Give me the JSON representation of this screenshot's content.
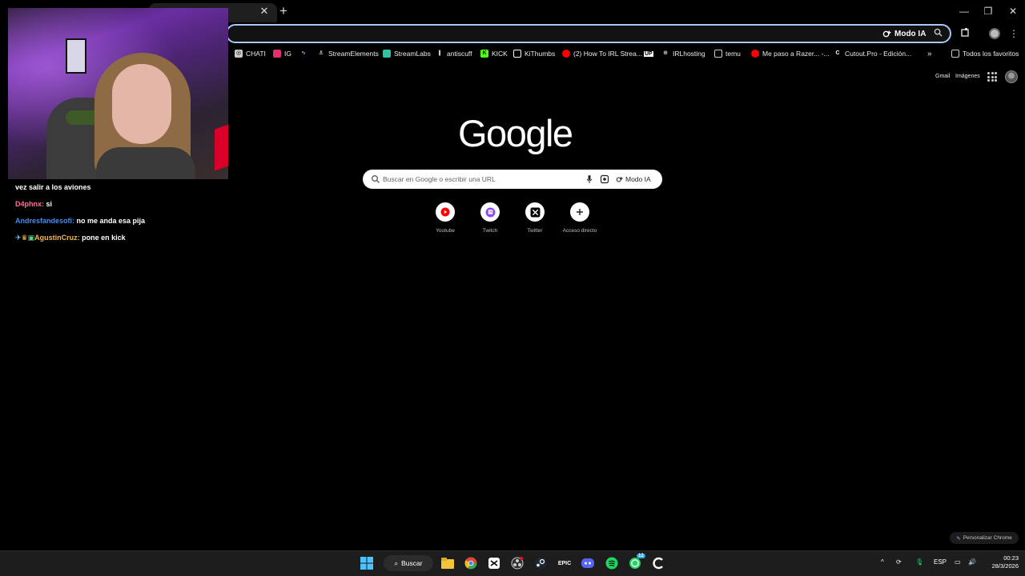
{
  "toolbar": {
    "modo_ia_label": "Modo IA"
  },
  "bookmarks": [
    {
      "label": "CHATI"
    },
    {
      "label": "IG"
    },
    {
      "label": ""
    },
    {
      "label": "StreamElements"
    },
    {
      "label": "StreamLabs"
    },
    {
      "label": "antiscuff"
    },
    {
      "label": "KICK"
    },
    {
      "label": "KiThumbs"
    },
    {
      "label": "(2) How To IRL Strea..."
    },
    {
      "label": "UP"
    },
    {
      "label": "IRLhosting"
    },
    {
      "label": "temu"
    },
    {
      "label": "Me paso a Razer... -..."
    },
    {
      "label": "Cutout.Pro - Edición..."
    }
  ],
  "all_favorites_label": "Todos los favoritos",
  "ntp": {
    "gmail": "Gmail",
    "images": "Imágenes",
    "logo": "Google",
    "search_placeholder": "Buscar en Google o escribir una URL",
    "ai_mode": "Modo IA",
    "shortcuts": [
      {
        "label": "Youtube",
        "icon": "youtube-icon"
      },
      {
        "label": "Twitch",
        "icon": "twitch-icon"
      },
      {
        "label": "Twitter",
        "icon": "x-icon"
      },
      {
        "label": "Acceso directo",
        "icon": "plus-icon"
      }
    ],
    "personalize": "Personalizar Chrome"
  },
  "chat": [
    {
      "user": "",
      "text": "vez salir a los aviones"
    },
    {
      "user": "D4phnx:",
      "text": "si"
    },
    {
      "user": "Andresfandesofi:",
      "text": "no me anda esa pija"
    },
    {
      "user": "AgustinCruz:",
      "text": "pone en kick"
    }
  ],
  "taskbar": {
    "search_label": "Buscar",
    "lang": "ESP",
    "time": "00:23",
    "date": "28/3/2026",
    "whatsapp_badge": "12"
  },
  "colors": {
    "accent": "#a8c7fa",
    "background": "#000000",
    "taskbar": "#1d1d1d"
  }
}
